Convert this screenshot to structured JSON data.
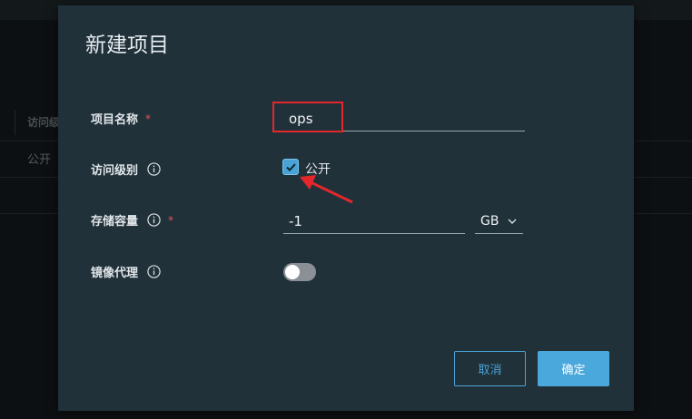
{
  "background": {
    "table_header": "访问级",
    "table_cell": "公开"
  },
  "modal": {
    "title": "新建项目",
    "fields": {
      "project_name": {
        "label": "项目名称",
        "required_mark": "*",
        "value": "ops"
      },
      "access_level": {
        "label": "访问级别",
        "checkbox_label": "公开",
        "checked": true
      },
      "storage": {
        "label": "存储容量",
        "required_mark": "*",
        "value": "-1",
        "unit": "GB"
      },
      "proxy_cache": {
        "label": "镜像代理",
        "enabled": false
      }
    },
    "buttons": {
      "cancel": "取消",
      "ok": "确定"
    }
  },
  "colors": {
    "modal_bg": "#21313a",
    "accent": "#4aa8dc",
    "annotation_red": "#e3272b"
  }
}
